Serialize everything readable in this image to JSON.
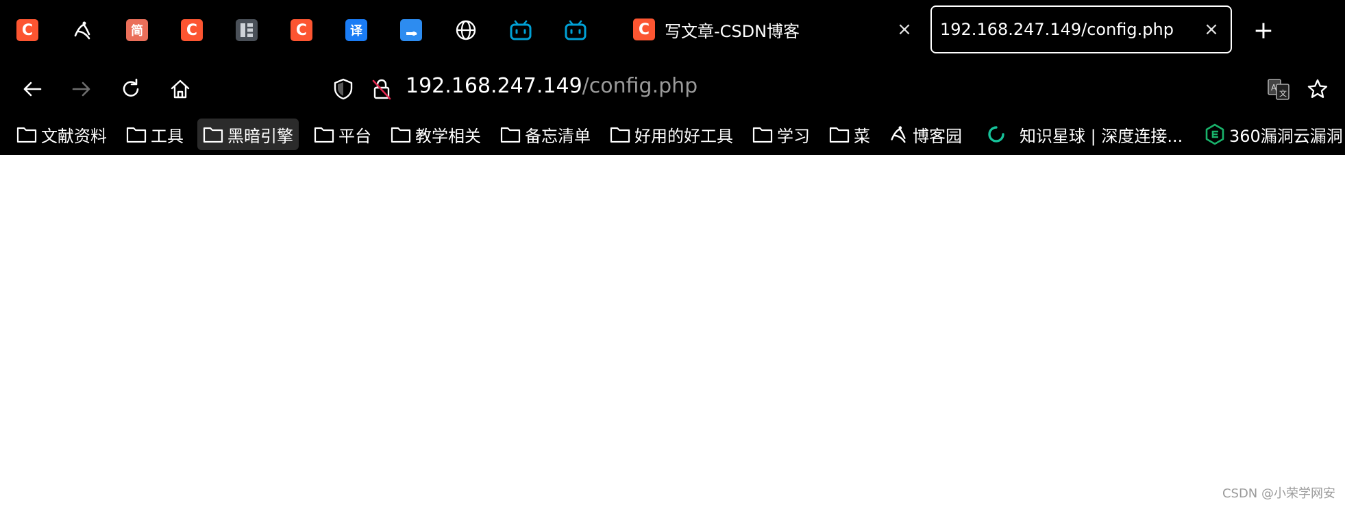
{
  "tabs": {
    "pinned": [
      {
        "icon": "csdn-icon",
        "glyph": "C"
      },
      {
        "icon": "cnblogs-icon"
      },
      {
        "icon": "jianshu-icon",
        "glyph": "简"
      },
      {
        "icon": "csdn-icon",
        "glyph": "C"
      },
      {
        "icon": "app-icon"
      },
      {
        "icon": "csdn-icon",
        "glyph": "C"
      },
      {
        "icon": "translate-icon",
        "glyph": "译"
      },
      {
        "icon": "cloud-icon"
      },
      {
        "icon": "globe-icon"
      },
      {
        "icon": "bilibili-icon"
      },
      {
        "icon": "bilibili-icon"
      }
    ],
    "tab1": {
      "title": "写文章-CSDN博客",
      "favicon_glyph": "C",
      "close": "×"
    },
    "tab2": {
      "title": "192.168.247.149/config.php",
      "close": "×"
    },
    "new_tab": "+"
  },
  "address_bar": {
    "host": "192.168.247.149",
    "path": "/config.php"
  },
  "bookmarks": [
    {
      "label": "文献资料",
      "type": "folder"
    },
    {
      "label": "工具",
      "type": "folder"
    },
    {
      "label": "黑暗引擎",
      "type": "folder",
      "active": true
    },
    {
      "label": "平台",
      "type": "folder"
    },
    {
      "label": "教学相关",
      "type": "folder"
    },
    {
      "label": "备忘清单",
      "type": "folder"
    },
    {
      "label": "好用的好工具",
      "type": "folder"
    },
    {
      "label": "学习",
      "type": "folder"
    },
    {
      "label": "菜",
      "type": "folder"
    },
    {
      "label": "博客园",
      "type": "site"
    },
    {
      "label": "知识星球 | 深度连接...",
      "type": "site"
    },
    {
      "label": "360漏洞云漏洞",
      "type": "site"
    }
  ],
  "watermark": "CSDN @小荣学网安",
  "colors": {
    "chrome_bg": "#000000",
    "page_bg": "#ffffff",
    "csdn": "#fc5531",
    "url_path": "#9a9a9a"
  }
}
